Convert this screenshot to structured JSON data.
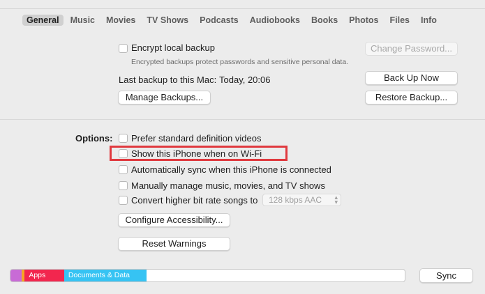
{
  "tabs": [
    {
      "label": "General",
      "active": true
    },
    {
      "label": "Music",
      "active": false
    },
    {
      "label": "Movies",
      "active": false
    },
    {
      "label": "TV Shows",
      "active": false
    },
    {
      "label": "Podcasts",
      "active": false
    },
    {
      "label": "Audiobooks",
      "active": false
    },
    {
      "label": "Books",
      "active": false
    },
    {
      "label": "Photos",
      "active": false
    },
    {
      "label": "Files",
      "active": false
    },
    {
      "label": "Info",
      "active": false
    }
  ],
  "backup": {
    "encrypt_label": "Encrypt local backup",
    "encrypt_checked": false,
    "encrypt_hint": "Encrypted backups protect passwords and sensitive personal data.",
    "change_password_label": "Change Password...",
    "last_backup_label": "Last backup to this Mac:",
    "last_backup_value": "Today, 20:06",
    "back_up_now_label": "Back Up Now",
    "manage_backups_label": "Manage Backups...",
    "restore_backup_label": "Restore Backup..."
  },
  "options": {
    "heading": "Options:",
    "items": [
      {
        "label": "Prefer standard definition videos",
        "checked": false
      },
      {
        "label": "Show this iPhone when on Wi-Fi",
        "checked": false
      },
      {
        "label": "Automatically sync when this iPhone is connected",
        "checked": false
      },
      {
        "label": "Manually manage music, movies, and TV shows",
        "checked": false
      },
      {
        "label": "Convert higher bit rate songs to",
        "checked": false
      }
    ],
    "bitrate_value": "128 kbps AAC",
    "configure_accessibility_label": "Configure Accessibility...",
    "reset_warnings_label": "Reset Warnings"
  },
  "storage": {
    "segments": [
      {
        "label": "",
        "color": "#c86bd6",
        "fraction": 0.028
      },
      {
        "label": "",
        "color": "#f5a623",
        "fraction": 0.008
      },
      {
        "label": "Apps",
        "color": "#f2264e",
        "fraction": 0.1
      },
      {
        "label": "Documents & Data",
        "color": "#36c3f3",
        "fraction": 0.21
      }
    ]
  },
  "sync_label": "Sync",
  "highlight_color": "#e0393e"
}
